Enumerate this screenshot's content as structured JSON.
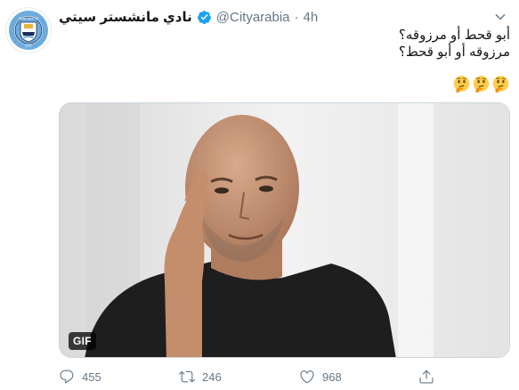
{
  "account": {
    "display_name": "نادي مانشستر سيتي",
    "handle": "@Cityarabia",
    "separator": "·",
    "time": "4h",
    "verified": true,
    "avatar_icon": "manchester-city-crest-icon"
  },
  "tweet": {
    "lines": [
      "أبو قحط أو مرزوقه؟",
      "مرزوقه أو أبو قحط؟"
    ],
    "emojis": [
      "thinking-face-icon",
      "thinking-face-icon",
      "thinking-face-icon"
    ]
  },
  "media": {
    "type": "gif",
    "badge": "GIF"
  },
  "actions": {
    "reply": {
      "icon": "reply-icon",
      "count": "455"
    },
    "retweet": {
      "icon": "retweet-icon",
      "count": "246"
    },
    "like": {
      "icon": "heart-icon",
      "count": "968"
    },
    "share": {
      "icon": "share-icon"
    }
  },
  "colors": {
    "text": "#14171a",
    "secondary": "#657786",
    "verified": "#1da1f2",
    "city_blue": "#6cabdd",
    "city_navy": "#1c2c5b"
  }
}
